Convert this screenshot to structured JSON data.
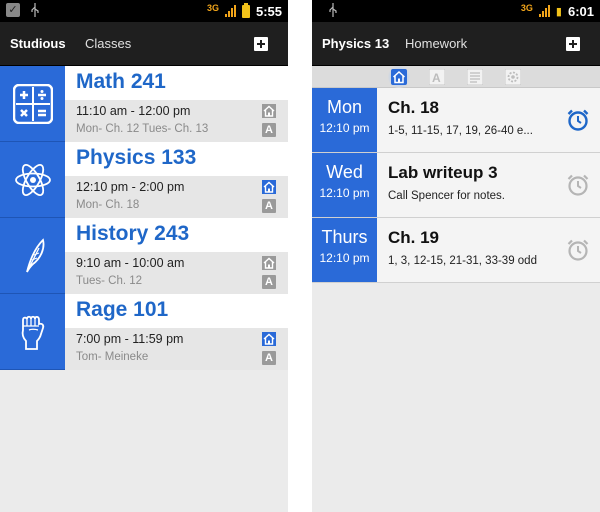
{
  "left": {
    "status": {
      "time": "5:55",
      "network": "3G"
    },
    "actionbar": {
      "title": "Studious",
      "subtitle": "Classes"
    },
    "classes": [
      {
        "name": "Math 241",
        "time": "11:10 am - 12:00 pm",
        "note": "Mon- Ch. 12  Tues- Ch. 13",
        "icon": "calculator-icon",
        "home_active": false
      },
      {
        "name": "Physics 133",
        "time": "12:10 pm - 2:00 pm",
        "note": "Mon- Ch. 18",
        "icon": "atom-icon",
        "home_active": true
      },
      {
        "name": "History 243",
        "time": "9:10 am - 10:00 am",
        "note": "Tues- Ch. 12",
        "icon": "feather-icon",
        "home_active": false
      },
      {
        "name": "Rage 101",
        "time": "7:00 pm - 11:59 pm",
        "note": "Tom- Meineke",
        "icon": "fist-icon",
        "home_active": true
      }
    ]
  },
  "right": {
    "status": {
      "time": "6:01",
      "network": "3G"
    },
    "actionbar": {
      "title": "Physics 13",
      "subtitle": "Homework"
    },
    "tabs": [
      "home-icon",
      "text-icon",
      "notes-icon",
      "settings-icon"
    ],
    "homework": [
      {
        "day": "Mon",
        "time": "12:10 pm",
        "title": "Ch. 18",
        "desc": "1-5, 11-15, 17, 19, 26-40 e...",
        "alarm_active": true
      },
      {
        "day": "Wed",
        "time": "12:10 pm",
        "title": "Lab writeup 3",
        "desc": "Call Spencer for notes.",
        "alarm_active": false
      },
      {
        "day": "Thurs",
        "time": "12:10 pm",
        "title": "Ch. 19",
        "desc": "1, 3, 12-15, 21-31, 33-39 odd",
        "alarm_active": false
      }
    ]
  },
  "colors": {
    "accent": "#2a6ad8",
    "title_blue": "#1f67c8",
    "status_orange": "#f2a51a"
  }
}
